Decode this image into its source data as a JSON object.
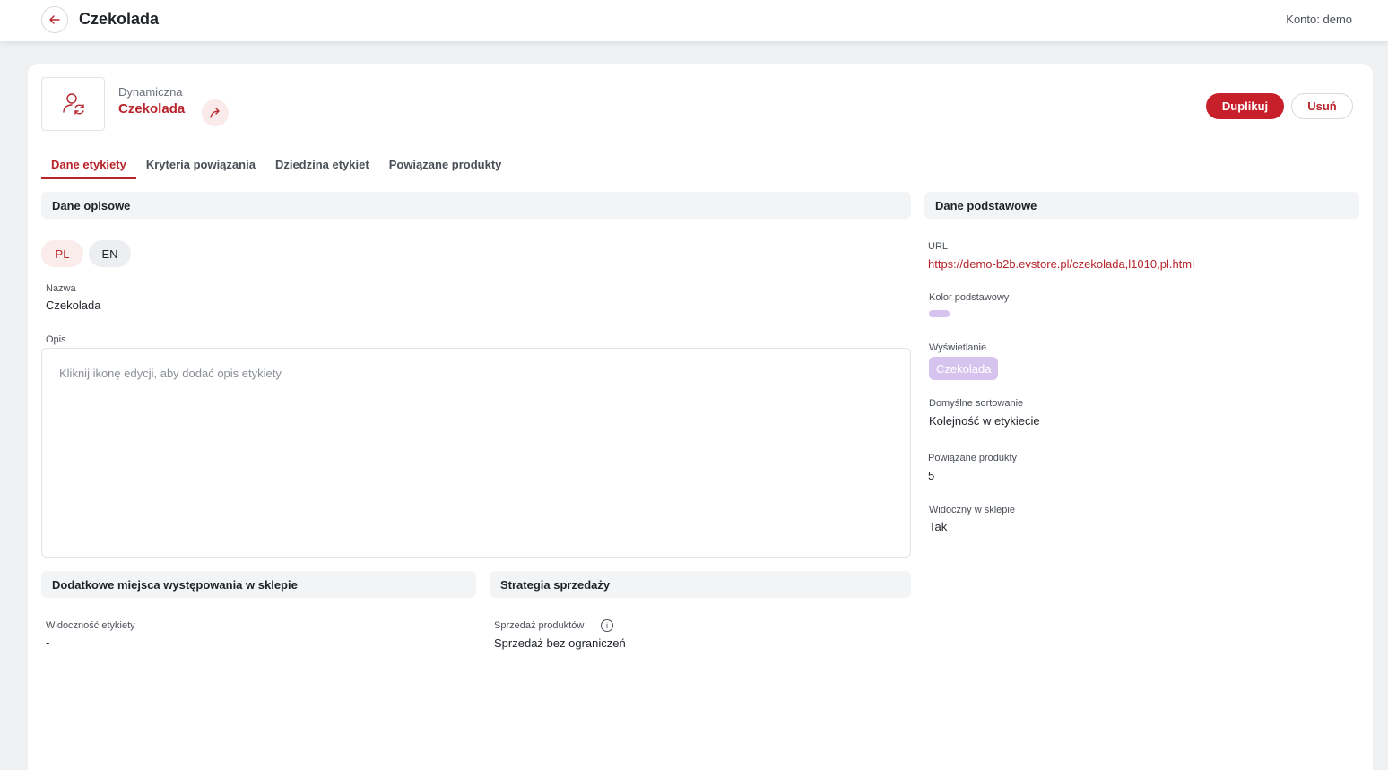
{
  "header": {
    "title": "Czekolada",
    "account_label": "Konto: demo"
  },
  "entity": {
    "type": "Dynamiczna",
    "name": "Czekolada"
  },
  "actions": {
    "duplicate": "Duplikuj",
    "delete": "Usuń"
  },
  "tabs": [
    {
      "label": "Dane etykiety",
      "active": true
    },
    {
      "label": "Kryteria powiązania",
      "active": false
    },
    {
      "label": "Dziedzina etykiet",
      "active": false
    },
    {
      "label": "Powiązane produkty",
      "active": false
    }
  ],
  "descriptive": {
    "title": "Dane opisowe",
    "languages": [
      "PL",
      "EN"
    ],
    "name_label": "Nazwa",
    "name_value": "Czekolada",
    "description_label": "Opis",
    "description_placeholder": "Kliknij ikonę edycji, aby dodać opis etykiety"
  },
  "additional": {
    "title": "Dodatkowe miejsca występowania w sklepie",
    "visibility_label": "Widoczność etykiety",
    "visibility_value": "-"
  },
  "strategy": {
    "title": "Strategia sprzedaży",
    "sales_label": "Sprzedaż produktów",
    "sales_value": "Sprzedaż bez ograniczeń"
  },
  "basic": {
    "title": "Dane podstawowe",
    "url_label": "URL",
    "url_value": "https://demo-b2b.evstore.pl/czekolada,l1010,pl.html",
    "color_label": "Kolor podstawowy",
    "color_value": "#d6c4ee",
    "display_label": "Wyświetlanie",
    "display_value": "Czekolada",
    "sort_label": "Domyślne sortowanie",
    "sort_value": "Kolejność w etykiecie",
    "related_label": "Powiązane produkty",
    "related_value": "5",
    "visible_label": "Widoczny w sklepie",
    "visible_value": "Tak"
  },
  "colors": {
    "accent": "#c8202b",
    "brand_text": "#b8242b",
    "background": "#eef0f2"
  },
  "icons": {
    "back": "arrow-left-icon",
    "label": "user-sync-icon",
    "share": "share-arrow-icon",
    "info": "info-icon"
  }
}
